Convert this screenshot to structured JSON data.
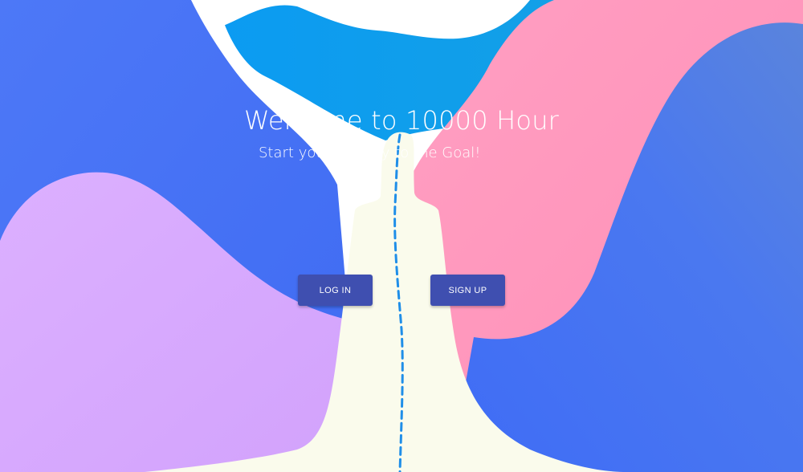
{
  "hero": {
    "title": "Welcome to 10000 Hour",
    "subtitle": "Start your journey to the Goal!"
  },
  "actions": {
    "login_label": "LOG IN",
    "signup_label": "SIGN UP"
  },
  "colors": {
    "button": "#3f4fb0",
    "blue_wave": "#4a72f5",
    "sky_wave": "#0aa0f0",
    "pink_wave": "#ff97bd",
    "purple_wave": "#d9a8ff",
    "path_cream": "#fafbec",
    "trail_dash": "#1f8ee8"
  }
}
